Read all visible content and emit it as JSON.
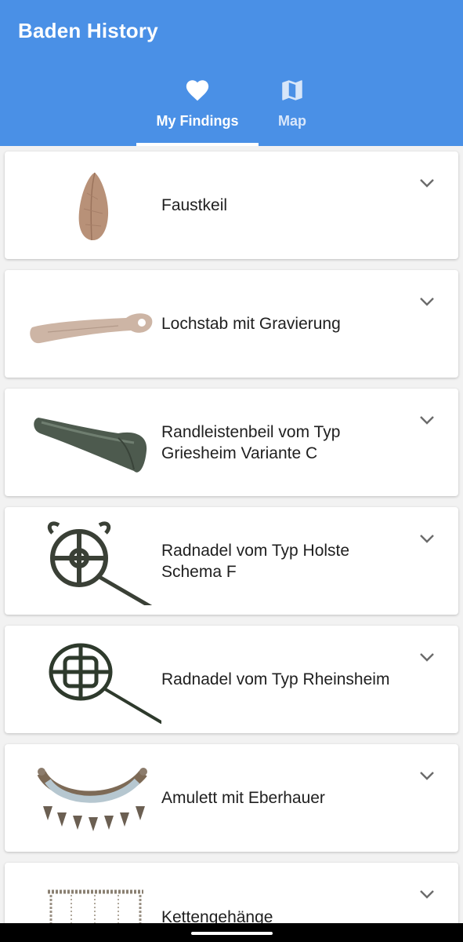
{
  "app": {
    "title": "Baden History",
    "primary_color": "#4a90e6"
  },
  "tabs": [
    {
      "label": "My Findings",
      "icon": "heart-icon",
      "selected": true
    },
    {
      "label": "Map",
      "icon": "map-icon",
      "selected": false
    }
  ],
  "findings": [
    {
      "title": "Faustkeil",
      "image": "hand-axe-photo"
    },
    {
      "title": "Lochstab mit Gravierung",
      "image": "perforated-baton-photo"
    },
    {
      "title": "Randleistenbeil vom Typ Griesheim Variante C",
      "image": "flanged-axe-photo"
    },
    {
      "title": "Radnadel vom Typ Holste Schema F",
      "image": "wheel-pin-photo"
    },
    {
      "title": "Radnadel vom Typ Rheinsheim",
      "image": "wheel-pin-rheinsheim-photo"
    },
    {
      "title": "Amulett mit Eberhauer",
      "image": "boar-tusk-amulet-photo"
    },
    {
      "title": "Kettengehänge",
      "image": "chain-pendant-photo"
    }
  ]
}
